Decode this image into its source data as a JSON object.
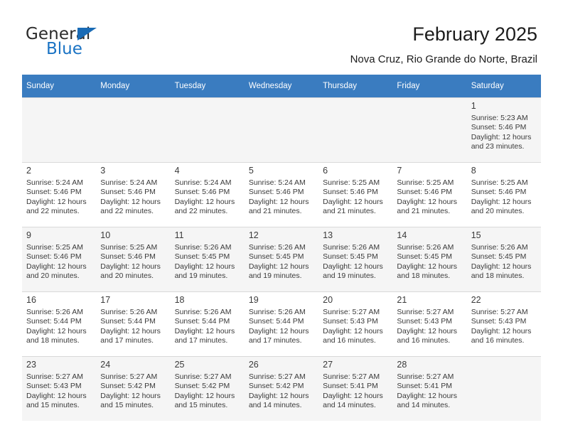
{
  "brand": {
    "name_part1": "General",
    "name_part2": "Blue",
    "triangle_color": "#1a6bb5",
    "blue_color": "#1a73c4"
  },
  "header": {
    "title": "February 2025",
    "subtitle": "Nova Cruz, Rio Grande do Norte, Brazil"
  },
  "theme": {
    "header_row_bg": "#3a7cc0",
    "header_row_text": "#ffffff",
    "shaded_row_bg": "#f5f5f5",
    "grid_line": "#d9d9d9"
  },
  "weekdays": [
    "Sunday",
    "Monday",
    "Tuesday",
    "Wednesday",
    "Thursday",
    "Friday",
    "Saturday"
  ],
  "weeks": [
    [
      {
        "day": "",
        "blank": true,
        "sunrise": "",
        "sunset": "",
        "daylight_line1": "",
        "daylight_line2": ""
      },
      {
        "day": "",
        "blank": true,
        "sunrise": "",
        "sunset": "",
        "daylight_line1": "",
        "daylight_line2": ""
      },
      {
        "day": "",
        "blank": true,
        "sunrise": "",
        "sunset": "",
        "daylight_line1": "",
        "daylight_line2": ""
      },
      {
        "day": "",
        "blank": true,
        "sunrise": "",
        "sunset": "",
        "daylight_line1": "",
        "daylight_line2": ""
      },
      {
        "day": "",
        "blank": true,
        "sunrise": "",
        "sunset": "",
        "daylight_line1": "",
        "daylight_line2": ""
      },
      {
        "day": "",
        "blank": true,
        "sunrise": "",
        "sunset": "",
        "daylight_line1": "",
        "daylight_line2": ""
      },
      {
        "day": "1",
        "blank": false,
        "sunrise": "Sunrise: 5:23 AM",
        "sunset": "Sunset: 5:46 PM",
        "daylight_line1": "Daylight: 12 hours",
        "daylight_line2": "and 23 minutes."
      }
    ],
    [
      {
        "day": "2",
        "blank": false,
        "sunrise": "Sunrise: 5:24 AM",
        "sunset": "Sunset: 5:46 PM",
        "daylight_line1": "Daylight: 12 hours",
        "daylight_line2": "and 22 minutes."
      },
      {
        "day": "3",
        "blank": false,
        "sunrise": "Sunrise: 5:24 AM",
        "sunset": "Sunset: 5:46 PM",
        "daylight_line1": "Daylight: 12 hours",
        "daylight_line2": "and 22 minutes."
      },
      {
        "day": "4",
        "blank": false,
        "sunrise": "Sunrise: 5:24 AM",
        "sunset": "Sunset: 5:46 PM",
        "daylight_line1": "Daylight: 12 hours",
        "daylight_line2": "and 22 minutes."
      },
      {
        "day": "5",
        "blank": false,
        "sunrise": "Sunrise: 5:24 AM",
        "sunset": "Sunset: 5:46 PM",
        "daylight_line1": "Daylight: 12 hours",
        "daylight_line2": "and 21 minutes."
      },
      {
        "day": "6",
        "blank": false,
        "sunrise": "Sunrise: 5:25 AM",
        "sunset": "Sunset: 5:46 PM",
        "daylight_line1": "Daylight: 12 hours",
        "daylight_line2": "and 21 minutes."
      },
      {
        "day": "7",
        "blank": false,
        "sunrise": "Sunrise: 5:25 AM",
        "sunset": "Sunset: 5:46 PM",
        "daylight_line1": "Daylight: 12 hours",
        "daylight_line2": "and 21 minutes."
      },
      {
        "day": "8",
        "blank": false,
        "sunrise": "Sunrise: 5:25 AM",
        "sunset": "Sunset: 5:46 PM",
        "daylight_line1": "Daylight: 12 hours",
        "daylight_line2": "and 20 minutes."
      }
    ],
    [
      {
        "day": "9",
        "blank": false,
        "sunrise": "Sunrise: 5:25 AM",
        "sunset": "Sunset: 5:46 PM",
        "daylight_line1": "Daylight: 12 hours",
        "daylight_line2": "and 20 minutes."
      },
      {
        "day": "10",
        "blank": false,
        "sunrise": "Sunrise: 5:25 AM",
        "sunset": "Sunset: 5:46 PM",
        "daylight_line1": "Daylight: 12 hours",
        "daylight_line2": "and 20 minutes."
      },
      {
        "day": "11",
        "blank": false,
        "sunrise": "Sunrise: 5:26 AM",
        "sunset": "Sunset: 5:45 PM",
        "daylight_line1": "Daylight: 12 hours",
        "daylight_line2": "and 19 minutes."
      },
      {
        "day": "12",
        "blank": false,
        "sunrise": "Sunrise: 5:26 AM",
        "sunset": "Sunset: 5:45 PM",
        "daylight_line1": "Daylight: 12 hours",
        "daylight_line2": "and 19 minutes."
      },
      {
        "day": "13",
        "blank": false,
        "sunrise": "Sunrise: 5:26 AM",
        "sunset": "Sunset: 5:45 PM",
        "daylight_line1": "Daylight: 12 hours",
        "daylight_line2": "and 19 minutes."
      },
      {
        "day": "14",
        "blank": false,
        "sunrise": "Sunrise: 5:26 AM",
        "sunset": "Sunset: 5:45 PM",
        "daylight_line1": "Daylight: 12 hours",
        "daylight_line2": "and 18 minutes."
      },
      {
        "day": "15",
        "blank": false,
        "sunrise": "Sunrise: 5:26 AM",
        "sunset": "Sunset: 5:45 PM",
        "daylight_line1": "Daylight: 12 hours",
        "daylight_line2": "and 18 minutes."
      }
    ],
    [
      {
        "day": "16",
        "blank": false,
        "sunrise": "Sunrise: 5:26 AM",
        "sunset": "Sunset: 5:44 PM",
        "daylight_line1": "Daylight: 12 hours",
        "daylight_line2": "and 18 minutes."
      },
      {
        "day": "17",
        "blank": false,
        "sunrise": "Sunrise: 5:26 AM",
        "sunset": "Sunset: 5:44 PM",
        "daylight_line1": "Daylight: 12 hours",
        "daylight_line2": "and 17 minutes."
      },
      {
        "day": "18",
        "blank": false,
        "sunrise": "Sunrise: 5:26 AM",
        "sunset": "Sunset: 5:44 PM",
        "daylight_line1": "Daylight: 12 hours",
        "daylight_line2": "and 17 minutes."
      },
      {
        "day": "19",
        "blank": false,
        "sunrise": "Sunrise: 5:26 AM",
        "sunset": "Sunset: 5:44 PM",
        "daylight_line1": "Daylight: 12 hours",
        "daylight_line2": "and 17 minutes."
      },
      {
        "day": "20",
        "blank": false,
        "sunrise": "Sunrise: 5:27 AM",
        "sunset": "Sunset: 5:43 PM",
        "daylight_line1": "Daylight: 12 hours",
        "daylight_line2": "and 16 minutes."
      },
      {
        "day": "21",
        "blank": false,
        "sunrise": "Sunrise: 5:27 AM",
        "sunset": "Sunset: 5:43 PM",
        "daylight_line1": "Daylight: 12 hours",
        "daylight_line2": "and 16 minutes."
      },
      {
        "day": "22",
        "blank": false,
        "sunrise": "Sunrise: 5:27 AM",
        "sunset": "Sunset: 5:43 PM",
        "daylight_line1": "Daylight: 12 hours",
        "daylight_line2": "and 16 minutes."
      }
    ],
    [
      {
        "day": "23",
        "blank": false,
        "sunrise": "Sunrise: 5:27 AM",
        "sunset": "Sunset: 5:43 PM",
        "daylight_line1": "Daylight: 12 hours",
        "daylight_line2": "and 15 minutes."
      },
      {
        "day": "24",
        "blank": false,
        "sunrise": "Sunrise: 5:27 AM",
        "sunset": "Sunset: 5:42 PM",
        "daylight_line1": "Daylight: 12 hours",
        "daylight_line2": "and 15 minutes."
      },
      {
        "day": "25",
        "blank": false,
        "sunrise": "Sunrise: 5:27 AM",
        "sunset": "Sunset: 5:42 PM",
        "daylight_line1": "Daylight: 12 hours",
        "daylight_line2": "and 15 minutes."
      },
      {
        "day": "26",
        "blank": false,
        "sunrise": "Sunrise: 5:27 AM",
        "sunset": "Sunset: 5:42 PM",
        "daylight_line1": "Daylight: 12 hours",
        "daylight_line2": "and 14 minutes."
      },
      {
        "day": "27",
        "blank": false,
        "sunrise": "Sunrise: 5:27 AM",
        "sunset": "Sunset: 5:41 PM",
        "daylight_line1": "Daylight: 12 hours",
        "daylight_line2": "and 14 minutes."
      },
      {
        "day": "28",
        "blank": false,
        "sunrise": "Sunrise: 5:27 AM",
        "sunset": "Sunset: 5:41 PM",
        "daylight_line1": "Daylight: 12 hours",
        "daylight_line2": "and 14 minutes."
      },
      {
        "day": "",
        "blank": true,
        "sunrise": "",
        "sunset": "",
        "daylight_line1": "",
        "daylight_line2": ""
      }
    ]
  ]
}
